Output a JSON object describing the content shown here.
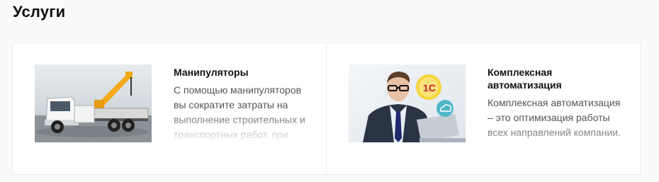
{
  "section": {
    "title": "Услуги"
  },
  "cards": [
    {
      "title": "Манипуляторы",
      "description": "С помощью манипуляторов вы сократите затраты на выполнение строительных и транспортных работ, при",
      "image_icon": "crane-truck-photo"
    },
    {
      "title": "Комплексная автоматизация",
      "description": "Комплексная автоматизация – это оптимизация работы всех направлений компании.",
      "image_icon": "businessman-1c-photo",
      "badge_label": "1С"
    }
  ]
}
